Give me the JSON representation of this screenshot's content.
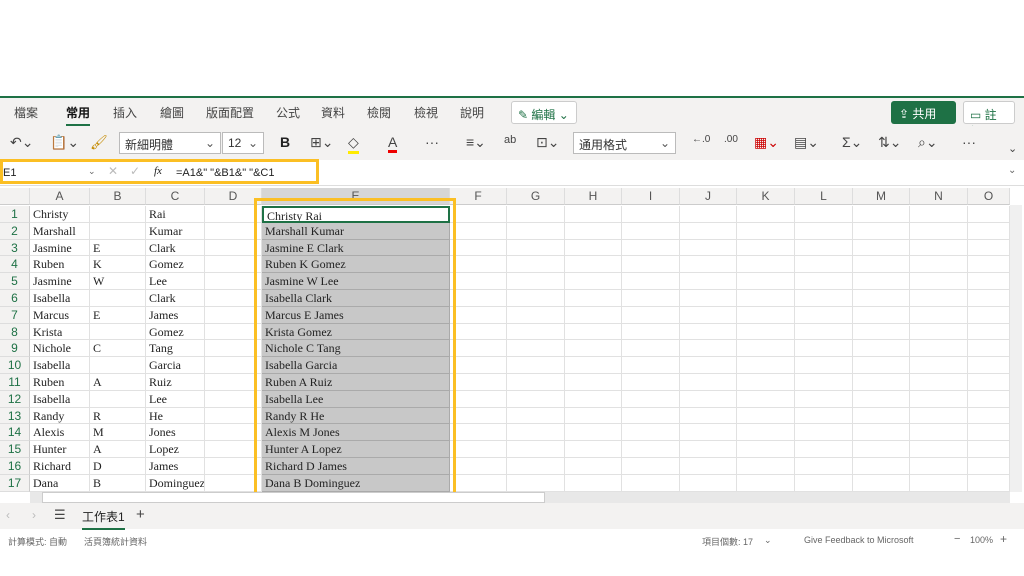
{
  "ribbon": {
    "tabs": [
      "檔案",
      "常用",
      "插入",
      "繪圖",
      "版面配置",
      "公式",
      "資料",
      "檢閱",
      "檢視",
      "說明"
    ],
    "active": "常用",
    "edit_label": "編輯",
    "share_label": "共用",
    "comment_label": "註解"
  },
  "toolbar": {
    "font": "新細明體",
    "size": "12",
    "bold": "B",
    "number_format": "通用格式",
    "more": "···"
  },
  "formula_bar": {
    "name_box": "E1",
    "fx": "fx",
    "formula": "=A1&\" \"&B1&\" \"&C1"
  },
  "columns": [
    "A",
    "B",
    "C",
    "D",
    "E",
    "F",
    "G",
    "H",
    "I",
    "J",
    "K",
    "L",
    "M",
    "N",
    "O"
  ],
  "rows": [
    [
      "Christy",
      "",
      "Rai",
      "",
      "Christy  Rai"
    ],
    [
      "Marshall",
      "",
      "Kumar",
      "",
      "Marshall  Kumar"
    ],
    [
      "Jasmine",
      "E",
      "Clark",
      "",
      "Jasmine E Clark"
    ],
    [
      "Ruben",
      "K",
      "Gomez",
      "",
      "Ruben K Gomez"
    ],
    [
      "Jasmine",
      "W",
      "Lee",
      "",
      "Jasmine W Lee"
    ],
    [
      "Isabella",
      "",
      "Clark",
      "",
      "Isabella  Clark"
    ],
    [
      "Marcus",
      "E",
      "James",
      "",
      "Marcus E James"
    ],
    [
      "Krista",
      "",
      "Gomez",
      "",
      "Krista  Gomez"
    ],
    [
      "Nichole",
      "C",
      "Tang",
      "",
      "Nichole C Tang"
    ],
    [
      "Isabella",
      "",
      "Garcia",
      "",
      "Isabella  Garcia"
    ],
    [
      "Ruben",
      "A",
      "Ruiz",
      "",
      "Ruben A Ruiz"
    ],
    [
      "Isabella",
      "",
      "Lee",
      "",
      "Isabella  Lee"
    ],
    [
      "Randy",
      "R",
      "He",
      "",
      "Randy R He"
    ],
    [
      "Alexis",
      "M",
      "Jones",
      "",
      "Alexis M Jones"
    ],
    [
      "Hunter",
      "A",
      "Lopez",
      "",
      "Hunter A Lopez"
    ],
    [
      "Richard",
      "D",
      "James",
      "",
      "Richard D James"
    ],
    [
      "Dana",
      "B",
      "Dominguez",
      "",
      "Dana B Dominguez"
    ]
  ],
  "sheet": {
    "name": "工作表1",
    "add": "+"
  },
  "status": {
    "calc_mode": "計算模式: 自動",
    "workbook_stats": "活頁簿統計資料",
    "count": "項目個數: 17",
    "feedback": "Give Feedback to Microsoft",
    "zoom": "100%"
  },
  "colors": {
    "accent": "#1e7145",
    "highlight": "#fbbf24",
    "selection": "#c8c8c8"
  }
}
